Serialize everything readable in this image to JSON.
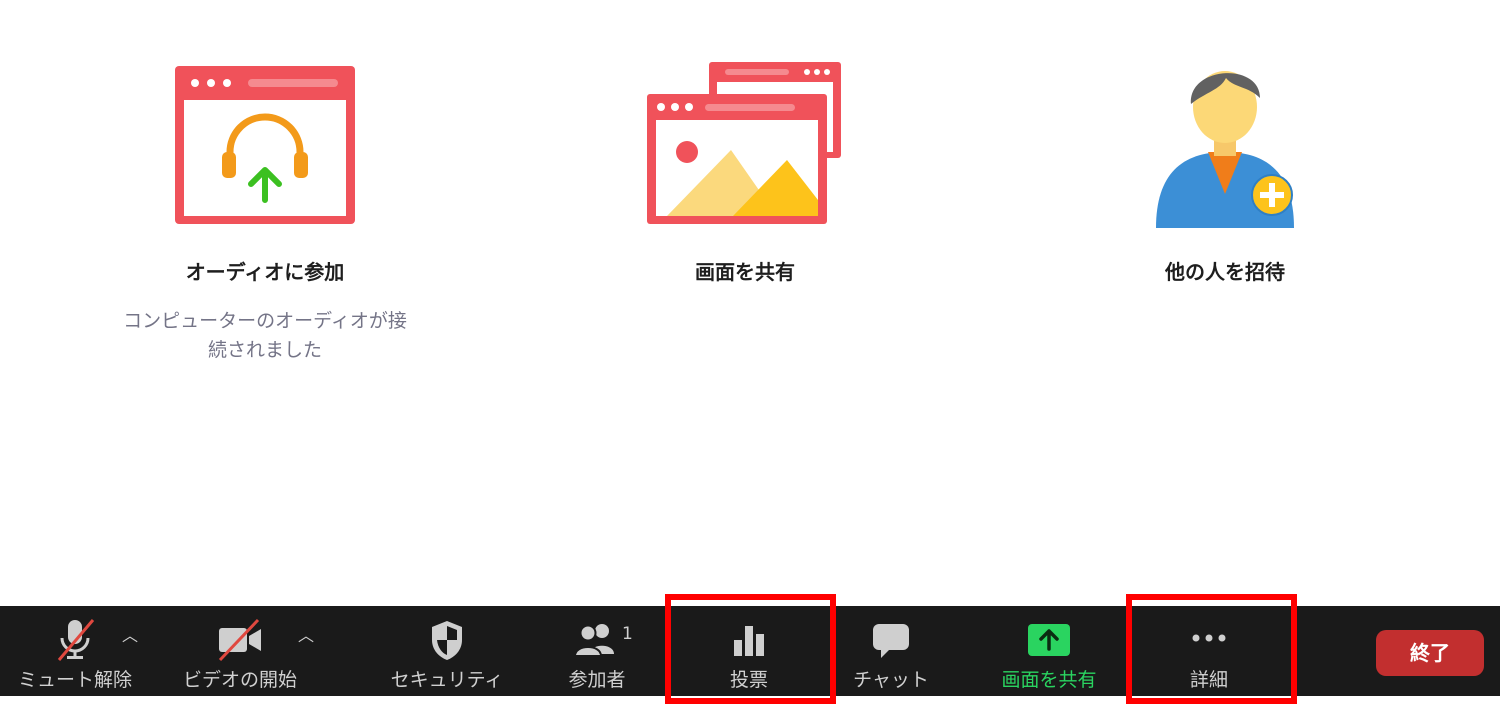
{
  "cards": {
    "audio": {
      "title": "オーディオに参加",
      "status_line1": "コンピューターのオーディオが接",
      "status_line2": "続されました"
    },
    "share": {
      "title": "画面を共有"
    },
    "invite": {
      "title": "他の人を招待"
    }
  },
  "toolbar": {
    "mute_label": "ミュート解除",
    "video_label": "ビデオの開始",
    "security_label": "セキュリティ",
    "participants_label": "参加者",
    "participants_count": "1",
    "polls_label": "投票",
    "chat_label": "チャット",
    "share_label": "画面を共有",
    "more_label": "詳細",
    "end_label": "終了"
  },
  "colors": {
    "toolbar_bg": "#1a1a1a",
    "icon_red": "#f0525a",
    "share_green": "#2ad460",
    "end_red": "#c22f2f",
    "highlight": "#ff0000"
  }
}
